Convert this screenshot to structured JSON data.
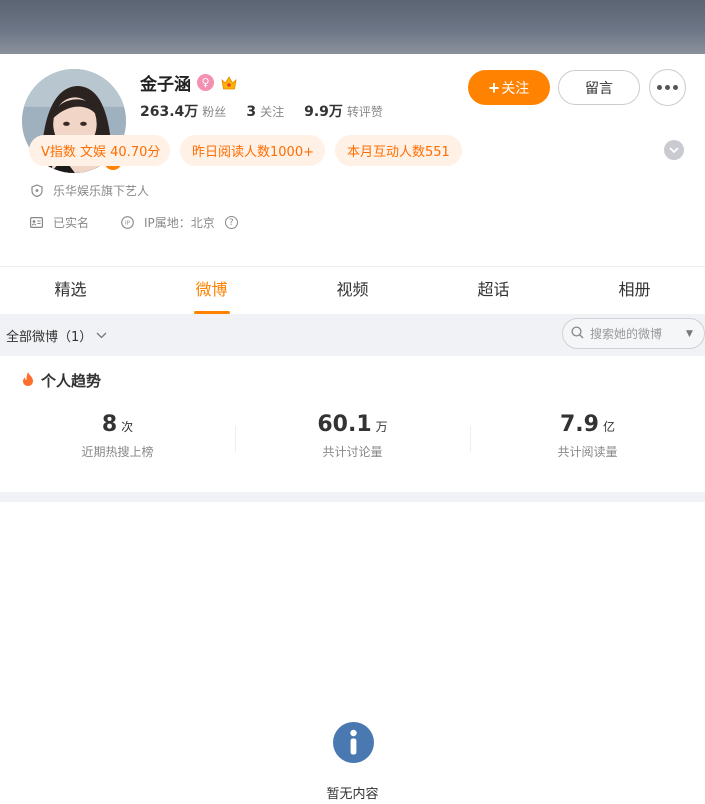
{
  "profile": {
    "name": "金子涵",
    "followers_count": "263.4万",
    "followers_label": "粉丝",
    "following_count": "3",
    "following_label": "关注",
    "reposts_count": "9.9万",
    "reposts_label": "转评赞",
    "verified_badge": "V",
    "gender_icon": "female-icon",
    "member_icon": "crown-icon"
  },
  "actions": {
    "follow_label": "关注",
    "message_label": "留言",
    "more_icon": "more-dots-icon"
  },
  "tags": [
    "V指数 文娱 40.70分",
    "昨日阅读人数1000+",
    "本月互动人数551"
  ],
  "info": {
    "agency": "乐华娱乐旗下艺人",
    "real_name_status": "已实名",
    "ip_location": "IP属地：北京"
  },
  "tabs": [
    {
      "label": "精选",
      "active": false
    },
    {
      "label": "微博",
      "active": true
    },
    {
      "label": "视频",
      "active": false
    },
    {
      "label": "超话",
      "active": false
    },
    {
      "label": "相册",
      "active": false
    }
  ],
  "filter": {
    "dropdown_label": "全部微博（1）",
    "search_placeholder": "搜索她的微博"
  },
  "trend": {
    "title": "个人趋势",
    "stats": [
      {
        "value": "8",
        "unit": "次",
        "label": "近期热搜上榜"
      },
      {
        "value": "60.1",
        "unit": "万",
        "label": "共计讨论量"
      },
      {
        "value": "7.9",
        "unit": "亿",
        "label": "共计阅读量"
      }
    ]
  },
  "empty_state": {
    "text": "暂无内容"
  },
  "colors": {
    "accent": "#ff8200",
    "tag_bg": "#fff1e6",
    "tag_text": "#ff6d00",
    "info_icon": "#4a78b0"
  }
}
